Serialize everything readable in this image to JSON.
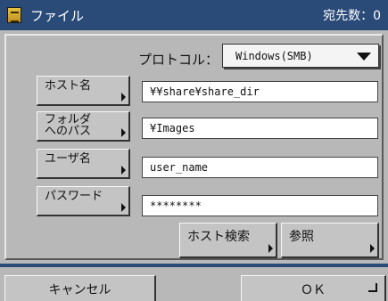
{
  "window": {
    "title": "ファイル",
    "destination_count": "宛先数：0"
  },
  "protocol": {
    "label": "プロトコル：",
    "selected": "Windows(SMB)"
  },
  "fields": [
    {
      "label": "ホスト名",
      "value": "¥¥share¥share_dir"
    },
    {
      "label": "フォルダ\nへのパス",
      "value": "¥Images"
    },
    {
      "label": "ユーザ名",
      "value": "user_name"
    },
    {
      "label": "パスワード",
      "value": "********"
    }
  ],
  "actions": {
    "host_search": "ホスト検索",
    "browse": "参照"
  },
  "footer": {
    "cancel": "キャンセル",
    "ok": "ＯＫ"
  }
}
